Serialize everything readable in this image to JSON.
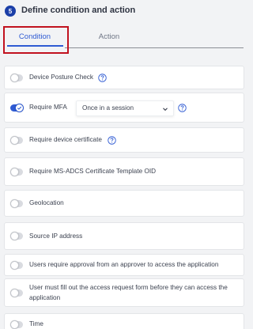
{
  "header": {
    "step_number": "5",
    "title": "Define condition and action"
  },
  "tabs": [
    {
      "label": "Condition",
      "active": true
    },
    {
      "label": "Action",
      "active": false
    }
  ],
  "conditions": [
    {
      "label": "Device Posture Check",
      "enabled": false,
      "has_help": true
    },
    {
      "label": "Require MFA",
      "enabled": true,
      "has_help": true,
      "select_value": "Once in a session"
    },
    {
      "label": "Require device certificate",
      "enabled": false,
      "has_help": true
    },
    {
      "label": "Require MS-ADCS Certificate Template OID",
      "enabled": false,
      "has_help": false
    },
    {
      "label": "Geolocation",
      "enabled": false,
      "has_help": false
    },
    {
      "label": "Source IP address",
      "enabled": false,
      "has_help": false
    },
    {
      "label": "Users require approval from an approver to access the application",
      "enabled": false,
      "has_help": false
    },
    {
      "label": "User must fill out the access request form before they can access the application",
      "enabled": false,
      "has_help": false
    },
    {
      "label": "Time",
      "enabled": false,
      "has_help": false
    }
  ],
  "colors": {
    "accent": "#2f5bd3",
    "badge": "#1b3fa8",
    "highlight": "#c1121f"
  },
  "icons": {
    "help": "question-circle-icon",
    "chevron": "chevron-down-icon",
    "check": "check-icon"
  }
}
